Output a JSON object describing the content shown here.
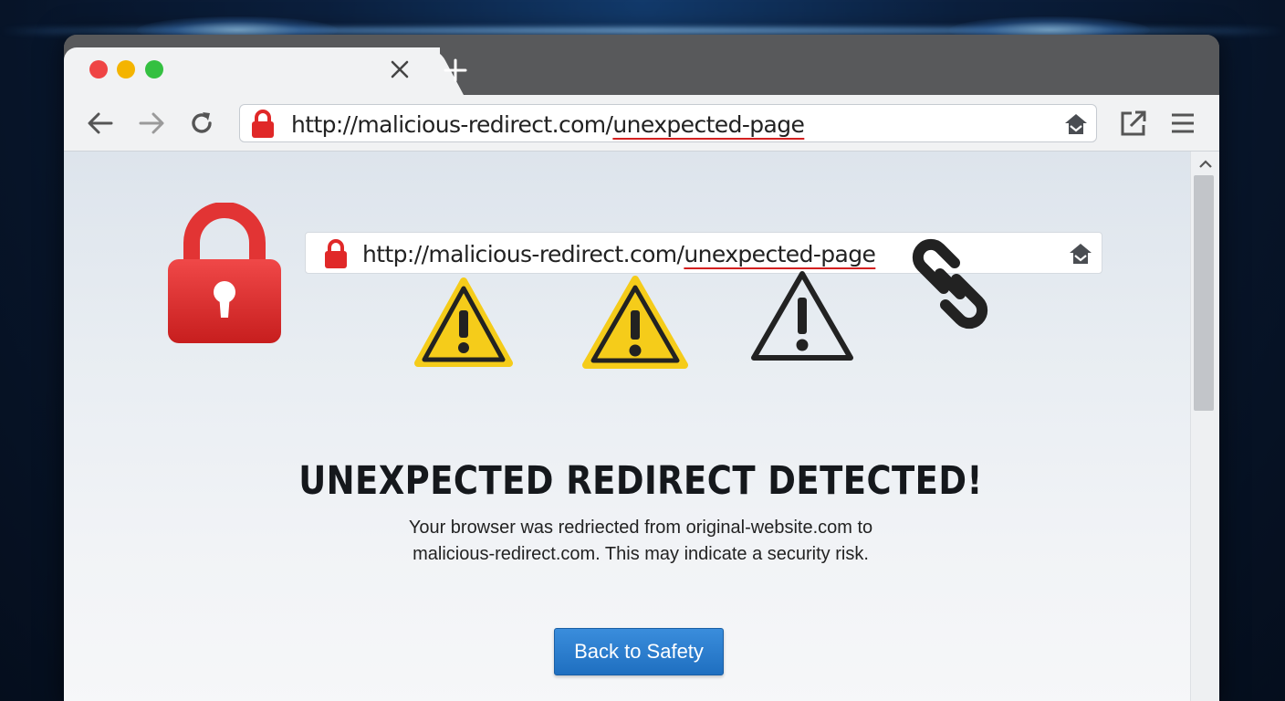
{
  "browser": {
    "tab": {
      "close_icon": "close-icon",
      "new_tab_icon": "plus-icon"
    },
    "window_controls": [
      "close",
      "minimize",
      "maximize"
    ],
    "address_bar": {
      "url_plain": "http://malicious-redirect.com/",
      "url_highlight": "unexpected-page",
      "lock_icon": "lock-icon",
      "home_icon": "home-icon"
    },
    "toolbar_icons": [
      "back-arrow-icon",
      "forward-arrow-icon",
      "reload-icon",
      "share-icon",
      "menu-icon"
    ]
  },
  "page": {
    "inner_address": {
      "url_plain": "http://malicious-redirect.com/",
      "url_highlight": "unexpected-page"
    },
    "icons": [
      "lock-icon",
      "warning-icon",
      "warning-icon",
      "warning-icon",
      "chain-link-icon"
    ],
    "headline": "UNEXPECTED REDIRECT DETECTED!",
    "description_line1": "Your browser was redriected from original-website.com to",
    "description_line2": "malicious-redirect.com. This may indicate a security risk.",
    "button_label": "Back to Safety"
  },
  "colors": {
    "danger": "#d32020",
    "warning": "#f5cc1a",
    "button": "#2a7ccf",
    "dot_red": "#ef4444",
    "dot_yellow": "#f4b400",
    "dot_green": "#34c040"
  }
}
